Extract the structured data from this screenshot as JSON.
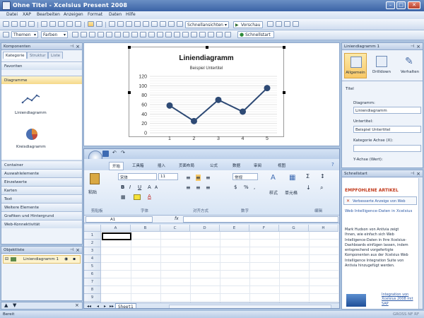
{
  "window": {
    "title": "Ohne Titel - Xcelsius Present 2008"
  },
  "menu": [
    "Datei",
    "XAP",
    "Bearbeiten",
    "Anzeigen",
    "Format",
    "Daten",
    "Hilfe"
  ],
  "toolbar": {
    "quick_views": "Schnellansichten",
    "preview": "Vorschau",
    "themes": "Themen",
    "colors": "Farben",
    "quickstart": "Schnellstart"
  },
  "components": {
    "title": "Komponenten",
    "tabs": [
      "Kategorie",
      "Struktur",
      "Liste"
    ],
    "categories_top": [
      "Favoriten",
      "Diagramme"
    ],
    "items": [
      "Liniendiagramm",
      "Kreisdiagramm"
    ],
    "categories_bottom": [
      "Container",
      "Auswahlelemente",
      "Einzelwerte",
      "Karten",
      "Text",
      "Weitere Elemente",
      "Grafiken und Hintergrund",
      "Web-Konnektivität"
    ]
  },
  "objects": {
    "title": "Objektliste",
    "item": "Liniendiagramm 1"
  },
  "chart_data": {
    "type": "line",
    "title": "Liniendiagramm",
    "subtitle": "Beispiel Untertitel",
    "categories": [
      "1",
      "2",
      "3",
      "4",
      "5"
    ],
    "values": [
      58,
      25,
      70,
      45,
      95
    ],
    "yticks": [
      "0",
      "20",
      "40",
      "60",
      "80",
      "100",
      "120"
    ],
    "ylim": [
      0,
      120
    ],
    "color": "#2e4a75"
  },
  "excel": {
    "tabs": [
      "开始",
      "工具箱",
      "插入",
      "页面布局",
      "公式",
      "数据",
      "审阅",
      "视图"
    ],
    "font_name": "宋体",
    "font_size": "11",
    "number_format": "常规",
    "paste_label": "粘贴",
    "styles_label": "样式",
    "cells_label": "单元格",
    "groups": [
      "剪贴板",
      "字体",
      "对齐方式",
      "数字",
      "编辑"
    ],
    "name_box": "A1",
    "fx": "fx",
    "columns": [
      "A",
      "B",
      "C",
      "D",
      "E",
      "F",
      "G",
      "H"
    ],
    "rows": [
      "1",
      "2",
      "3",
      "4",
      "5",
      "6",
      "7",
      "8",
      "9",
      "10"
    ],
    "sheet": "Sheet1"
  },
  "properties": {
    "title": "Liniendiagramm 1",
    "buttons": [
      "Allgemein",
      "Drilldown",
      "Verhalten"
    ],
    "section": "Titel",
    "diagramm_label": "Diagramm:",
    "diagramm_value": "Liniendiagramm",
    "untertitel_label": "Untertitel:",
    "untertitel_value": "Beispiel Untertitel",
    "x_axis_label": "Kategorie Achse (X):",
    "y_axis_label": "Y-Achse (Wert):"
  },
  "quickstart": {
    "title": "Schnellstart",
    "heading": "EMPFOHLENE ARTIKEL",
    "link1": "Verbesserte Anzeige von Web",
    "link2": "Web Intelligence-Daten in Xcelsius",
    "body": "Mark Hudson von Antivia zeigt Ihnen, wie einfach sich Web Intelligence-Daten in Ihre Xcelsius-Dashboards einfügen lassen, indem entsprechend vorgefertigte Komponenten aus der Xcelsius Web Intelligence Integration Suite von Antivia hinzugefügt werden.",
    "link3": "Integration von Xcelsius 2008 mit SAP"
  },
  "status": {
    "left": "Bereit",
    "right": "GROSS NF RF"
  }
}
